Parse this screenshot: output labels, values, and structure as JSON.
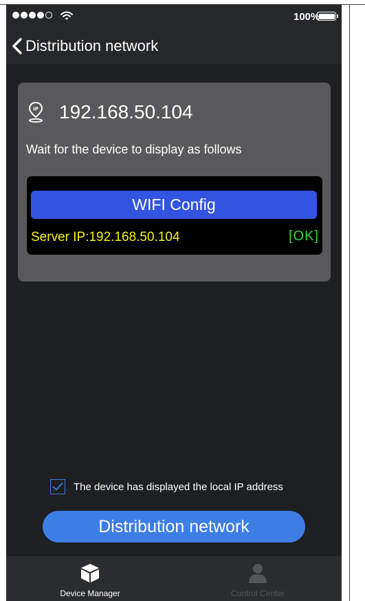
{
  "status_bar": {
    "signal_bars_filled": 4,
    "signal_bars_total": 5,
    "battery_percent": "100%",
    "icons": [
      "signal-dots-icon",
      "wifi-icon",
      "battery-icon"
    ]
  },
  "nav": {
    "title": "Distribution network",
    "back_icon": "chevron-left-icon"
  },
  "card": {
    "ip_icon": "ip-pin-icon",
    "ip_address": "192.168.50.104",
    "instruction": "Wait for the device to display as follows",
    "device_preview": {
      "header": "WIFI Config",
      "server_ip": "Server IP:192.168.50.104",
      "status": "[OK]"
    }
  },
  "confirm": {
    "checked": true,
    "label": "The device has displayed the local IP address"
  },
  "primary_button": {
    "label": "Distribution network"
  },
  "tab_bar": {
    "tabs": [
      {
        "label": "Device Manager",
        "icon": "cube-box-icon",
        "active": true
      },
      {
        "label": "Control Center",
        "icon": "person-icon",
        "active": false
      }
    ]
  },
  "colors": {
    "accent_blue": "#3d7de6",
    "config_bar_blue": "#3354e0",
    "server_ip_yellow": "#f4f40f",
    "ok_green": "#38d436",
    "background": "#1e1f21",
    "card": "#59595b"
  }
}
